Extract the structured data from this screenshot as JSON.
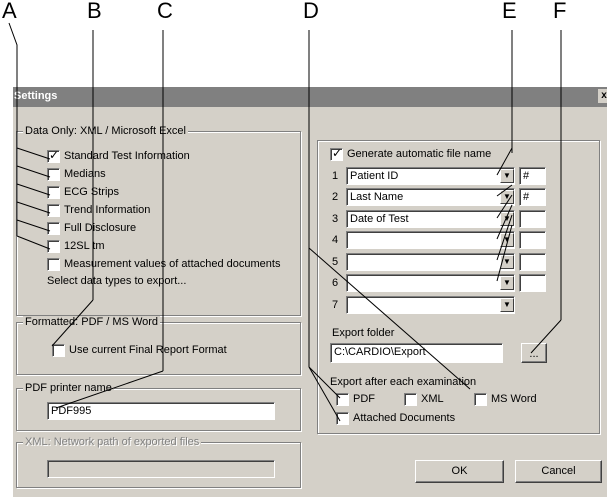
{
  "callouts": [
    "A",
    "B",
    "C",
    "D",
    "E",
    "F"
  ],
  "window": {
    "title": "Settings",
    "close_glyph": "x"
  },
  "data_only": {
    "legend": "Data Only: XML / Microsoft Excel",
    "options": [
      {
        "label": "Standard Test Information",
        "checked": true
      },
      {
        "label": "Medians",
        "checked": false
      },
      {
        "label": "ECG Strips",
        "checked": false
      },
      {
        "label": "Trend Information",
        "checked": false
      },
      {
        "label": "Full Disclosure",
        "checked": false
      },
      {
        "label": "12SL tm",
        "checked": false
      },
      {
        "label": "Measurement values of attached documents",
        "checked": false
      }
    ],
    "hint": "Select data types to export..."
  },
  "formatted": {
    "legend": "Formatted: PDF / MS Word",
    "option": {
      "label": "Use current Final Report Format",
      "checked": false
    }
  },
  "pdf_printer": {
    "legend": "PDF printer name",
    "value": "PDF995"
  },
  "xml_path": {
    "legend": "XML: Network path of exported files",
    "value": ""
  },
  "filename": {
    "generate": {
      "label": "Generate automatic file name",
      "checked": true
    },
    "rows": [
      {
        "num": "1",
        "value": "Patient ID",
        "sep": "#"
      },
      {
        "num": "2",
        "value": "Last Name",
        "sep": "#"
      },
      {
        "num": "3",
        "value": "Date of Test",
        "sep": ""
      },
      {
        "num": "4",
        "value": "",
        "sep": ""
      },
      {
        "num": "5",
        "value": "",
        "sep": ""
      },
      {
        "num": "6",
        "value": "",
        "sep": ""
      },
      {
        "num": "7",
        "value": ""
      }
    ]
  },
  "export_folder": {
    "label": "Export folder",
    "value": "C:\\CARDIO\\Export",
    "browse_label": "..."
  },
  "export_after": {
    "label": "Export after each examination",
    "pdf": {
      "label": "PDF",
      "checked": false
    },
    "xml": {
      "label": "XML",
      "checked": false
    },
    "msword": {
      "label": "MS Word",
      "checked": false
    },
    "attached": {
      "label": "Attached Documents",
      "checked": false
    }
  },
  "buttons": {
    "ok": "OK",
    "cancel": "Cancel"
  }
}
